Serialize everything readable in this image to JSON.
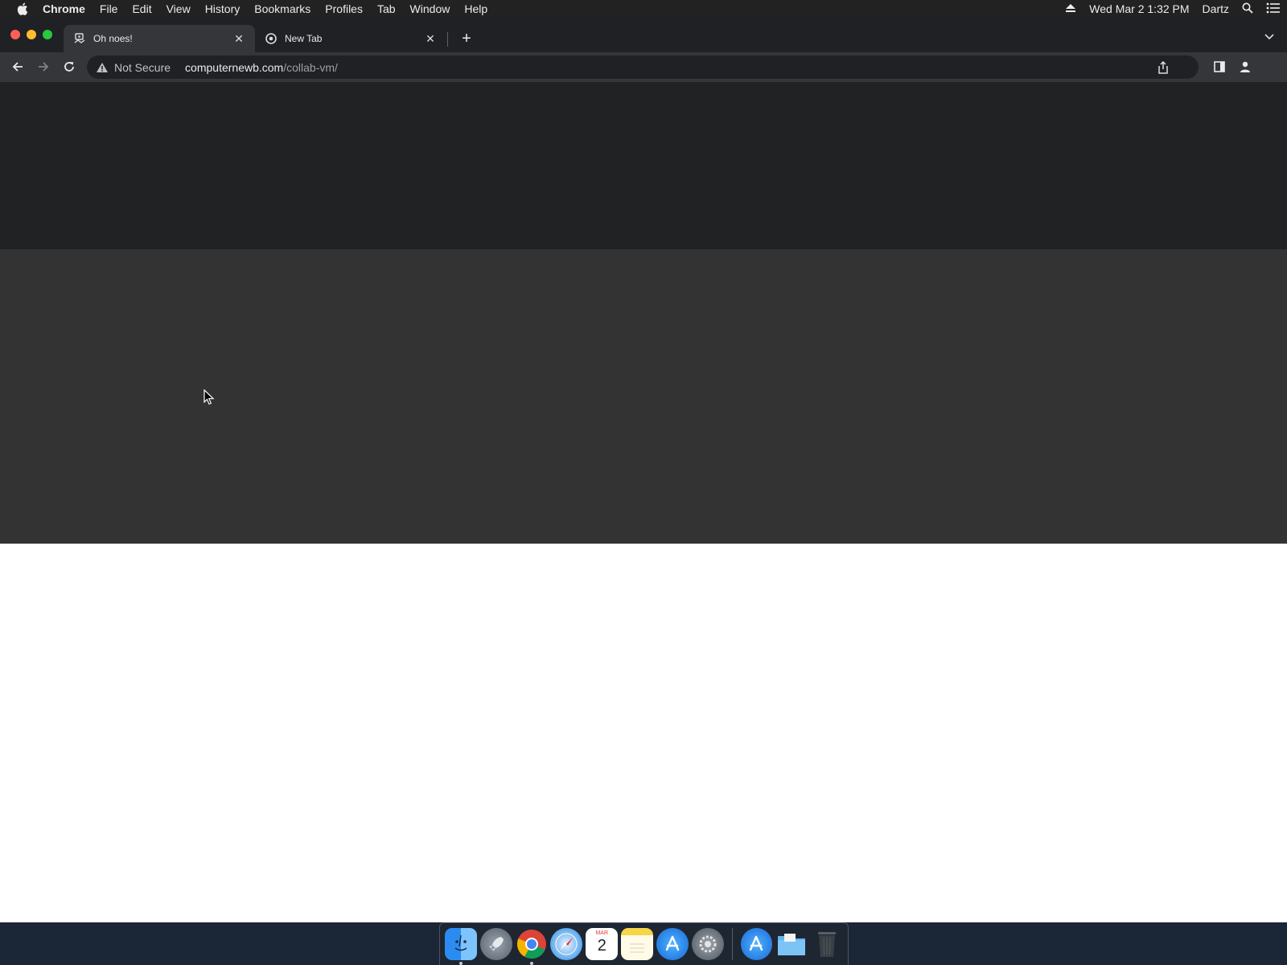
{
  "menubar": {
    "app": "Chrome",
    "items": [
      "File",
      "Edit",
      "View",
      "History",
      "Bookmarks",
      "Profiles",
      "Tab",
      "Window",
      "Help"
    ],
    "datetime": "Wed Mar 2  1:32 PM",
    "user": "Dartz"
  },
  "tabs": [
    {
      "title": "Oh noes!",
      "active": true
    },
    {
      "title": "New Tab",
      "active": false
    }
  ],
  "omnibox": {
    "security": "Not Secure",
    "host": "computernewb.com",
    "path": "/collab-vm/"
  },
  "dock": {
    "calendar_month": "MAR",
    "calendar_day": "2"
  },
  "colors": {
    "page_dark_band": "#212224",
    "page_gray_band": "#333333",
    "page_background": "#ffffff"
  }
}
